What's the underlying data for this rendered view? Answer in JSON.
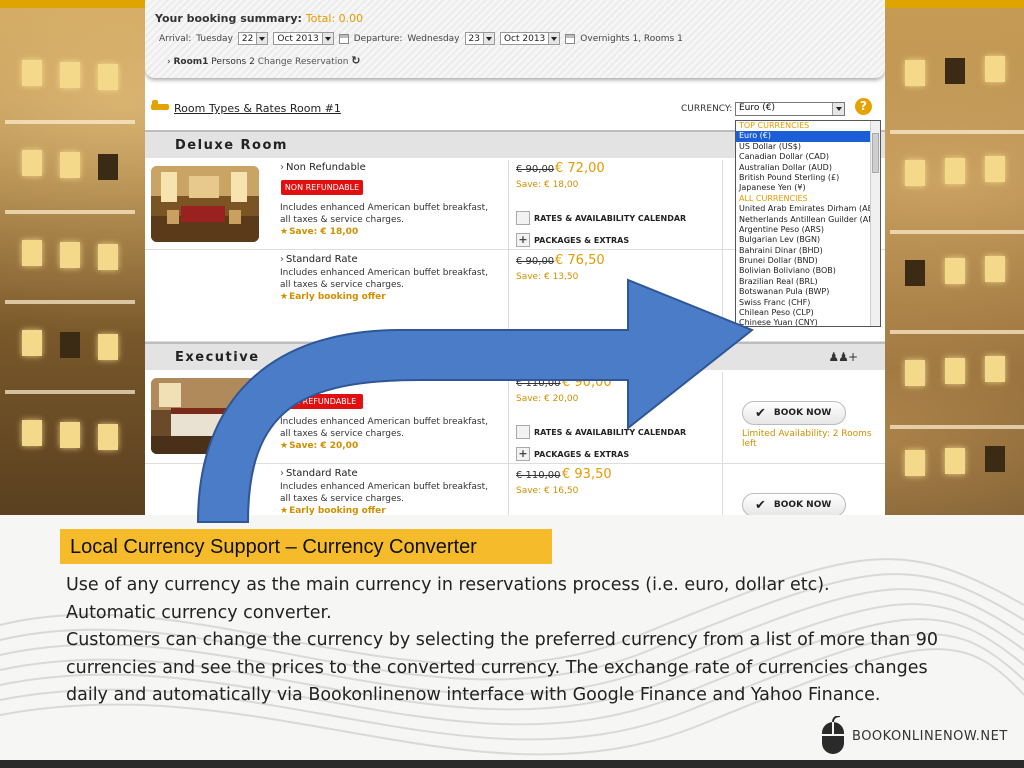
{
  "booking": {
    "summary_label": "Your booking summary:",
    "total": "Total: 0.00",
    "arrival_label": "Arrival:",
    "arrival_day": "Tuesday",
    "arrival_date": "22",
    "arrival_month": "Oct 2013",
    "departure_label": "Departure:",
    "departure_day": "Wednesday",
    "departure_date": "23",
    "departure_month": "Oct 2013",
    "stay_info": "Overnights 1, Rooms 1",
    "room_label": "Room1",
    "persons": "Persons 2",
    "change_link": "Change Reservation",
    "room_types_link": "Room Types & Rates Room #1",
    "currency_label": "CURRENCY:",
    "currency_selected": "Euro (€)",
    "help": "?"
  },
  "currency_list": [
    {
      "label": "TOP CURRENCIES",
      "kind": "group"
    },
    {
      "label": "Euro (€)",
      "kind": "selected"
    },
    {
      "label": "US Dollar (US$)",
      "kind": "option"
    },
    {
      "label": "Canadian Dollar (CAD)",
      "kind": "option"
    },
    {
      "label": "Australian Dollar (AUD)",
      "kind": "option"
    },
    {
      "label": "British Pound Sterling (£)",
      "kind": "option"
    },
    {
      "label": "Japanese Yen (¥)",
      "kind": "option"
    },
    {
      "label": "ALL CURRENCIES",
      "kind": "group"
    },
    {
      "label": "United Arab Emirates Dirham (AED)",
      "kind": "option"
    },
    {
      "label": "Netherlands Antillean Guilder (ANG)",
      "kind": "option"
    },
    {
      "label": "Argentine Peso (ARS)",
      "kind": "option"
    },
    {
      "label": "Bulgarian Lev (BGN)",
      "kind": "option"
    },
    {
      "label": "Bahraini Dinar (BHD)",
      "kind": "option"
    },
    {
      "label": "Brunei Dollar (BND)",
      "kind": "option"
    },
    {
      "label": "Bolivian Boliviano (BOB)",
      "kind": "option"
    },
    {
      "label": "Brazilian Real (BRL)",
      "kind": "option"
    },
    {
      "label": "Botswanan Pula (BWP)",
      "kind": "option"
    },
    {
      "label": "Swiss Franc (CHF)",
      "kind": "option"
    },
    {
      "label": "Chilean Peso (CLP)",
      "kind": "option"
    },
    {
      "label": "Chinese Yuan (CNY)",
      "kind": "option"
    }
  ],
  "rooms": [
    {
      "name": "Deluxe Room",
      "rates": [
        {
          "name": "Non Refundable",
          "badge": "NON REFUNDABLE",
          "desc": "Includes enhanced American buffet breakfast, all taxes & service charges.",
          "save_note": "Save: € 18,00",
          "old_price": "€ 90,00",
          "new_price": "€ 72,00",
          "save_line": "Save: € 18,00",
          "calendar": "RATES & AVAILABILITY CALENDAR",
          "packages": "PACKAGES & EXTRAS"
        },
        {
          "name": "Standard Rate",
          "desc": "Includes enhanced American buffet breakfast, all taxes & service charges.",
          "save_note": "Early booking offer",
          "old_price": "€ 90,00",
          "new_price": "€ 76,50",
          "save_line": "Save: € 13,50"
        }
      ]
    },
    {
      "name": "Executive Room",
      "visible_name": "Executive",
      "rates": [
        {
          "name": "Non Refundable",
          "visible_name": "fundable",
          "badge": "NON REFUNDABLE",
          "visible_badge": "ON REFUNDABLE",
          "desc": "Includes enhanced American buffet breakfast, all taxes & service charges.",
          "save_note": "Save: € 20,00",
          "old_price": "€ 110,00",
          "new_price": "€ 90,00",
          "save_line": "Save: € 20,00",
          "calendar": "RATES & AVAILABILITY CALENDAR",
          "packages": "PACKAGES & EXTRAS",
          "book": "BOOK NOW",
          "availability": "Limited Availability: 2 Rooms left"
        },
        {
          "name": "Standard Rate",
          "desc": "Includes enhanced American buffet breakfast, all taxes & service charges.",
          "save_note": "Early booking offer",
          "old_price": "€ 110,00",
          "new_price": "€ 93,50",
          "save_line": "Save: € 16,50",
          "book": "BOOK NOW"
        }
      ]
    }
  ],
  "slide": {
    "caption": "Local Currency Support – Currency Converter",
    "paragraphs": [
      "Use of any currency as the main currency in reservations process (i.e. euro, dollar etc).",
      "Automatic currency converter.",
      "Customers can change the currency by selecting the preferred currency from a list of more than 90 currencies and see the prices to the converted currency. The exchange rate of currencies changes daily and automatically via Bookonlinenow interface with Google Finance and Yahoo Finance."
    ],
    "logo_text": "BOOKONLINENOW.NET"
  },
  "colors": {
    "accent_orange": "#e39b00",
    "caption_yellow": "#f5bb2b",
    "arrow_blue": "#4a7cc7",
    "badge_red": "#e01010",
    "selected_blue": "#1c5ed6"
  }
}
